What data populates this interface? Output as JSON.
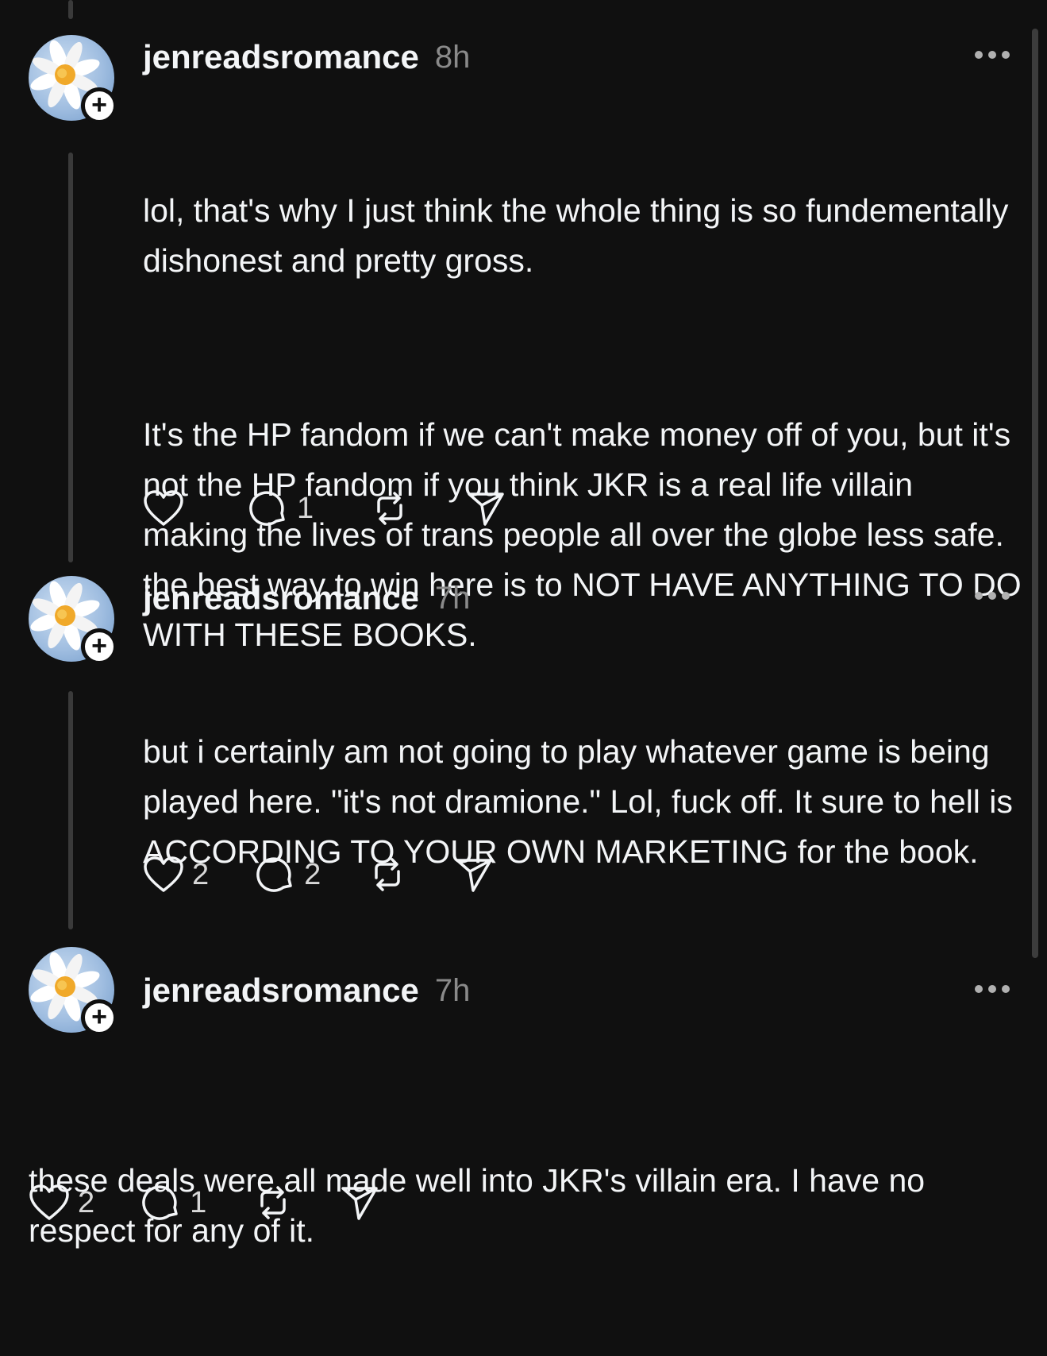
{
  "posts": [
    {
      "username": "jenreadsromance",
      "time": "8h",
      "paragraphs": [
        "lol, that's why I just think the whole thing is so fundementally dishonest and pretty gross.",
        "It's the HP fandom if we can't make money off of you, but it's not the HP fandom if you think JKR is a real life villain making the lives of trans people all over the globe less safe. the best way to win here is to NOT HAVE ANYTHING TO DO WITH THESE BOOKS."
      ],
      "likes": "",
      "replies": "1"
    },
    {
      "username": "jenreadsromance",
      "time": "7h",
      "paragraphs": [
        "but i certainly am not going to play whatever game is being played here. \"it's not dramione.\" Lol, fuck off. It sure to hell is ACCORDING TO YOUR OWN MARKETING for the book."
      ],
      "likes": "2",
      "replies": "2"
    },
    {
      "username": "jenreadsromance",
      "time": "7h",
      "paragraphs": [
        "these deals were all made well into JKR's villain era. I have no respect for any of it."
      ],
      "likes": "2",
      "replies": "1"
    }
  ],
  "icons": {
    "like": "heart-icon",
    "reply": "comment-icon",
    "repost": "repost-icon",
    "share": "send-icon",
    "more": "more-icon",
    "follow": "plus-icon"
  },
  "colors": {
    "background": "#101010",
    "text": "#f3f5f7",
    "muted": "#8a8a8a"
  }
}
